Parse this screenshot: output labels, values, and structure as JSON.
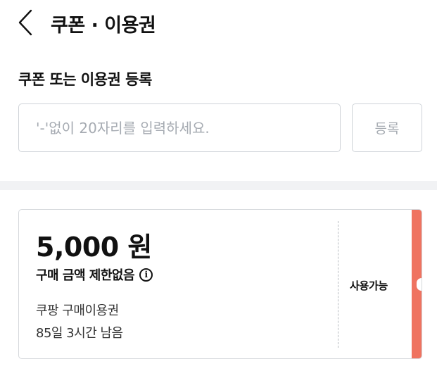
{
  "header": {
    "title": "쿠폰 · 이용권",
    "back_icon": "chevron-left-icon"
  },
  "register": {
    "section_title": "쿠폰 또는 이용권 등록",
    "input_placeholder": "'-'없이 20자리를 입력하세요.",
    "input_value": "",
    "button_label": "등록"
  },
  "coupons": [
    {
      "amount": "5,000 원",
      "limit": "구매 금액 제한없음",
      "info_icon": "info-icon",
      "type": "쿠팡 구매이용권",
      "remaining": "85일 3시간 남음",
      "status": "사용가능",
      "accent_color": "#ef7360"
    }
  ]
}
